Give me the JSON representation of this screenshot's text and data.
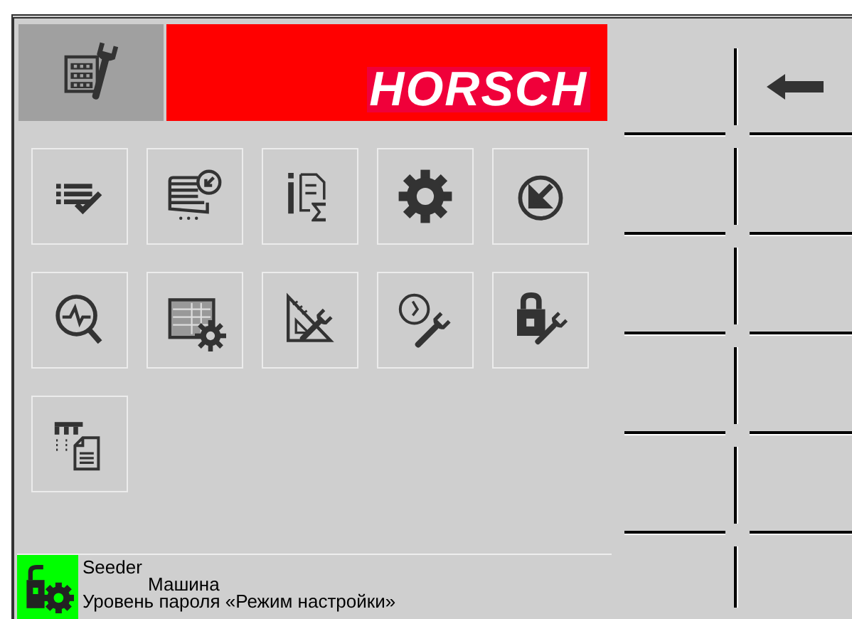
{
  "header": {
    "brand": "HORSCH"
  },
  "tiles": [
    {
      "kind": "checklist"
    },
    {
      "kind": "machine-download"
    },
    {
      "kind": "info-sum"
    },
    {
      "kind": "gear"
    },
    {
      "kind": "download"
    },
    {
      "kind": "diagnostics"
    },
    {
      "kind": "table-gear"
    },
    {
      "kind": "ruler-wrench"
    },
    {
      "kind": "clock-wrench"
    },
    {
      "kind": "lock-wrench"
    },
    {
      "kind": "table-document"
    }
  ],
  "status": {
    "machine_type": "Seeder",
    "machine": "Машина",
    "password_level": "Уровень пароля «Режим настройки»"
  },
  "softkeys": [
    {
      "kind": "blank"
    },
    {
      "kind": "back"
    },
    {
      "kind": "blank"
    },
    {
      "kind": "blank"
    },
    {
      "kind": "blank"
    },
    {
      "kind": "blank"
    },
    {
      "kind": "blank"
    },
    {
      "kind": "blank"
    },
    {
      "kind": "blank"
    },
    {
      "kind": "blank"
    },
    {
      "kind": "blank"
    },
    {
      "kind": "blank"
    }
  ]
}
